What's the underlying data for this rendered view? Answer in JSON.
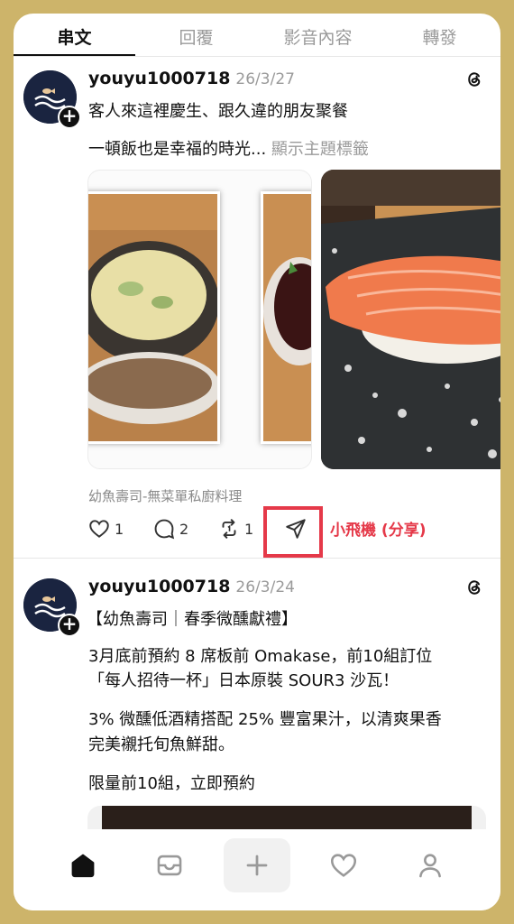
{
  "tabs": [
    "串文",
    "回覆",
    "影音內容",
    "轉發"
  ],
  "posts": [
    {
      "username": "youyu1000718",
      "date": "26/3/27",
      "lines": [
        "客人來這裡慶生、跟久違的朋友聚餐",
        "一頓飯也是幸福的時光..."
      ],
      "more": "顯示主題標籤",
      "location": "幼魚壽司-無菜單私廚料理",
      "likes": "1",
      "replies": "2",
      "reposts": "1"
    },
    {
      "username": "youyu1000718",
      "date": "26/3/24",
      "lines": [
        "【幼魚壽司｜春季微醺獻禮】",
        "3月底前預約 8 席板前 Omakase，前10組訂位",
        "「每人招待一杯」日本原裝 SOUR3 沙瓦！",
        "3% 微醺低酒精搭配 25% 豐富果汁，以清爽果香",
        "完美襯托旬魚鮮甜。",
        "限量前10組，立即預約"
      ]
    }
  ],
  "annotation": "小飛機 (分享)",
  "icons": {
    "avatar": "fish-logo-icon",
    "follow": "plus-icon",
    "threads": "threads-logo-icon",
    "like": "heart-icon",
    "reply": "comment-icon",
    "repost": "repost-icon",
    "share": "paper-plane-icon",
    "nav": [
      "home-icon",
      "inbox-icon",
      "plus-icon",
      "heart-icon",
      "profile-icon"
    ]
  },
  "colors": {
    "background": "#cdb46a",
    "highlight": "#e53949",
    "text": "#111111",
    "muted": "#9a9a9a"
  }
}
